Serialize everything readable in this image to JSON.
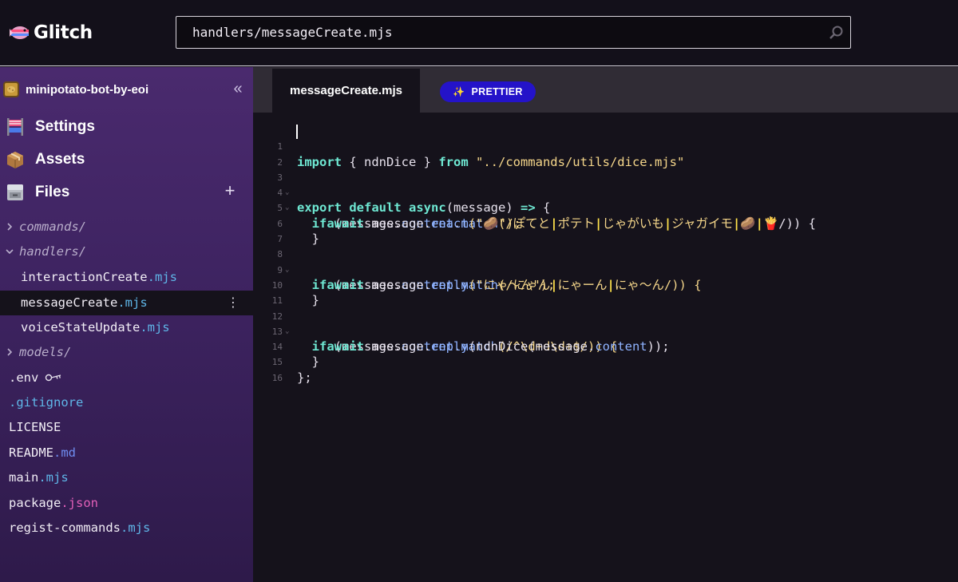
{
  "app": {
    "logo_text": "Glitch",
    "search": {
      "value": "handlers/messageCreate.mjs",
      "placeholder": ""
    }
  },
  "sidebar": {
    "project_name": "minipotato-bot-by-eoi",
    "collapse_glyph": "«",
    "nav": [
      {
        "label": "Settings",
        "icon": "settings-flag-icon"
      },
      {
        "label": "Assets",
        "icon": "package-box-icon"
      },
      {
        "label": "Files",
        "icon": "file-cabinet-icon"
      }
    ],
    "add_glyph": "+",
    "tree": [
      {
        "name": "commands/",
        "type": "folder",
        "expanded": false
      },
      {
        "name": "handlers/",
        "type": "folder",
        "expanded": true
      },
      {
        "base": "interactionCreate",
        "ext": ".mjs"
      },
      {
        "base": "messageCreate",
        "ext": ".mjs",
        "selected": true
      },
      {
        "base": "voiceStateUpdate",
        "ext": ".mjs"
      },
      {
        "name": "models/",
        "type": "folder",
        "expanded": false
      },
      {
        "base": ".env",
        "ext": "",
        "icon": "key-icon"
      },
      {
        "base": ".gitignore",
        "ext": ""
      },
      {
        "base": "LICENSE",
        "ext": ""
      },
      {
        "base": "README",
        "ext": ".md"
      },
      {
        "base": "main",
        "ext": ".mjs"
      },
      {
        "base": "package",
        "ext": ".json"
      },
      {
        "base": "regist-commands",
        "ext": ".mjs"
      }
    ],
    "file_menu_glyph": "⋮"
  },
  "editor": {
    "tab_label": "messageCreate.mjs",
    "prettier_label": "PRETTIER",
    "prettier_glyph": "✨",
    "line_numbers": [
      "1",
      "2",
      "3",
      "4",
      "5",
      "6",
      "7",
      "8",
      "9",
      "10",
      "11",
      "12",
      "13",
      "14",
      "15",
      "16"
    ],
    "code": {
      "l1": {
        "t1": "import",
        "t2": " { ndnDice } ",
        "t3": "from",
        "t4": " \"../commands/utils/dice.mjs\""
      },
      "l3": {
        "t1": "export",
        "t2": " ",
        "t3": "default",
        "t4": " ",
        "t5": "async",
        "t6": "(message) ",
        "t7": "=>",
        "t8": " {"
      },
      "l4": {
        "t1": "if",
        "t2": " (message.",
        "t3": "content",
        "t4": ".",
        "t5": "match",
        "t6": "(/ぽてと",
        "t7": "|",
        "t8": "ポテト",
        "t9": "|",
        "t10": "じゃがいも",
        "t11": "|",
        "t12": "ジャガイモ",
        "t13": "|",
        "t14": "🥔",
        "t15": "|",
        "t16": "🍟",
        "t17": "/)) {"
      },
      "l5": {
        "t1": "await",
        "t2": " message.",
        "t3": "react",
        "t4": "(\"🥔\");"
      },
      "l6": "}",
      "l8": {
        "t1": "if",
        "t2": " (message.",
        "t3": "content",
        "t4": ".",
        "t5": "match",
        "t6": "(/にゃん",
        "t7": "|",
        "t8": "にゃーん",
        "t9": "|",
        "t10": "にゃ〜ん/)) {"
      },
      "l9": {
        "t1": "await",
        "t2": " message.",
        "t3": "reply",
        "t4": "(\"にゃ〜ん\");"
      },
      "l10": "}",
      "l12": {
        "t1": "if",
        "t2": " (message.",
        "t3": "content",
        "t4": ".",
        "t5": "match",
        "t6": "(/^\\d+d\\d+$/)) {"
      },
      "l13": {
        "t1": "await",
        "t2": " message.",
        "t3": "reply",
        "t4": "(ndnDice(message.",
        "t5": "content",
        "t6": "));"
      },
      "l14": "}",
      "l15": "};"
    }
  },
  "colors": {
    "accent_blue": "#2413c9",
    "keyword": "#6ee7d2",
    "string": "#f5d68a",
    "property": "#8fb3ff",
    "ext_mjs": "#5fb6e8",
    "ext_md": "#6e8cf0",
    "ext_json": "#e25fb8"
  }
}
